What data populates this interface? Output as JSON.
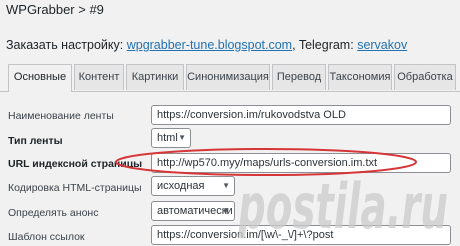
{
  "header": {
    "title": "WPGrabber > #9"
  },
  "promo": {
    "prefix": "Заказать настройку:",
    "site_link": "wpgrabber-tune.blogspot.com",
    "separator": ", Telegram:",
    "telegram_link": "servakov"
  },
  "tabs": [
    {
      "label": "Основные",
      "active": true
    },
    {
      "label": "Контент"
    },
    {
      "label": "Картинки"
    },
    {
      "label": "Синонимизация"
    },
    {
      "label": "Перевод"
    },
    {
      "label": "Таксономия"
    },
    {
      "label": "Обработка"
    }
  ],
  "form": {
    "feed_name": {
      "label": "Наименование ленты",
      "value": "https://conversion.im/rukovodstva OLD"
    },
    "feed_type": {
      "label": "Тип ленты",
      "value": "html"
    },
    "index_url": {
      "label": "URL индексной страницы",
      "value": "http://wp570.myy/maps/urls-conversion.im.txt"
    },
    "encoding": {
      "label": "Кодировка HTML-страницы",
      "value": "исходная"
    },
    "announce": {
      "label": "Определять анонс",
      "value": "автоматически"
    },
    "link_template": {
      "label": "Шаблон ссылок",
      "value": "https://conversion.im/[\\w\\-_\\/]+\\?post"
    }
  },
  "watermark": {
    "text": "postila.ru"
  },
  "colors": {
    "accent": "#2271b1",
    "highlight": "#d63638",
    "watermark": "#c9c9c9"
  }
}
